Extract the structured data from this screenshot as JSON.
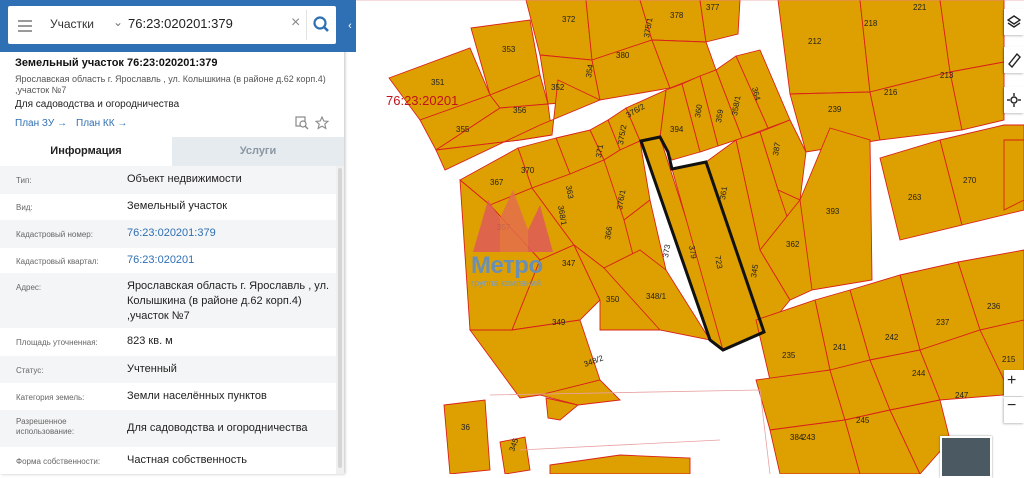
{
  "search": {
    "mode": "Участки",
    "query": "76:23:020201:379",
    "mode_chevron": "chevron-down-icon",
    "clear_icon": "close-icon",
    "search_icon": "search-icon"
  },
  "parcel": {
    "title": "Земельный участок 76:23:020201:379",
    "address_line1": "Ярославская область г. Ярославль , ул. Колышкина (в районе д.62 корп.4)",
    "address_line2": ",участок №7",
    "purpose": "Для садоводства и огородничества",
    "plan_zu": "План ЗУ →",
    "plan_kk": "План КК →"
  },
  "tabs": [
    "Информация",
    "Услуги"
  ],
  "details": [
    {
      "key": "Тип:",
      "value": [
        "Объект недвижимости"
      ]
    },
    {
      "key": "Вид:",
      "value": [
        "Земельный участок"
      ]
    },
    {
      "key": "Кадастровый номер:",
      "value": [
        "76:23:020201:379"
      ],
      "link": true
    },
    {
      "key": "Кадастровый квартал:",
      "value": [
        "76:23:020201"
      ],
      "link": true
    },
    {
      "key": "Адрес:",
      "value": [
        "Ярославская область г. Ярославль , ул.",
        "Колышкина (в районе д.62 корп.4)",
        ",участок №7"
      ]
    },
    {
      "key": "Площадь уточненная:",
      "value": [
        "823 кв. м"
      ]
    },
    {
      "key": "Статус:",
      "value": [
        "Учтенный"
      ]
    },
    {
      "key": "Категория земель:",
      "value": [
        "Земли населённых пунктов"
      ]
    },
    {
      "key": [
        "Разрешенное",
        "использование:"
      ],
      "value": [
        "Для садоводства и огородничества"
      ]
    },
    {
      "key": "Форма собственности:",
      "value": [
        "Частная собственность"
      ]
    }
  ],
  "map": {
    "quarter_label": "76:23:20201",
    "watermark_title": "Метро",
    "watermark_sub": "группа компаний",
    "parcel_labels": [
      "372",
      "378",
      "377",
      "221",
      "218",
      "212",
      "353",
      "380",
      "375/1",
      "354",
      "351",
      "352",
      "356",
      "355",
      "213",
      "216",
      "239",
      "364",
      "358/1",
      "359",
      "360",
      "394",
      "376/2",
      "375/2",
      "371",
      "363",
      "370",
      "367",
      "368/1",
      "376/1",
      "357",
      "366",
      "387",
      "361",
      "393",
      "379",
      "723",
      "362",
      "373",
      "345",
      "347",
      "348/1",
      "350",
      "349",
      "348/2",
      "263",
      "270",
      "236",
      "237",
      "242",
      "241",
      "235",
      "244",
      "247",
      "215",
      "245",
      "243",
      "36",
      "345",
      "384"
    ],
    "fill_color": "#dea000",
    "border_color": "#d8211c",
    "label_color": "#b22222"
  },
  "toolbar": {
    "layers_icon": "layers-icon",
    "ruler_icon": "ruler-icon",
    "locate_icon": "locate-icon",
    "zoom_in": "+",
    "zoom_out": "−"
  }
}
